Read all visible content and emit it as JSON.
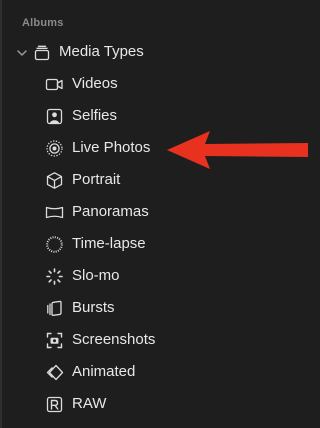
{
  "sidebar": {
    "section_header": "Albums",
    "group": {
      "label": "Media Types",
      "icon": "stack-icon",
      "expanded": true
    },
    "items": [
      {
        "label": "Videos",
        "icon": "video-camera-icon"
      },
      {
        "label": "Selfies",
        "icon": "selfie-portrait-icon"
      },
      {
        "label": "Live Photos",
        "icon": "live-photo-icon"
      },
      {
        "label": "Portrait",
        "icon": "cube-icon"
      },
      {
        "label": "Panoramas",
        "icon": "panorama-icon"
      },
      {
        "label": "Time-lapse",
        "icon": "timelapse-icon"
      },
      {
        "label": "Slo-mo",
        "icon": "slomo-icon"
      },
      {
        "label": "Bursts",
        "icon": "bursts-icon"
      },
      {
        "label": "Screenshots",
        "icon": "screenshot-icon"
      },
      {
        "label": "Animated",
        "icon": "animated-icon"
      },
      {
        "label": "RAW",
        "icon": "raw-icon"
      }
    ]
  },
  "annotation": {
    "arrow_color": "#e8311f",
    "points_to": "Live Photos"
  },
  "colors": {
    "background": "#1e1e1e",
    "text": "#e8e8e8",
    "section_header": "#8a8a8e",
    "icon": "#dcdcdc"
  }
}
